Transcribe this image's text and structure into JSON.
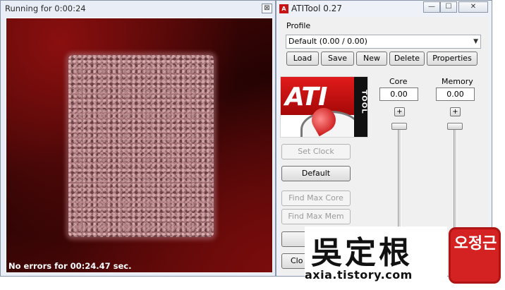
{
  "render_window": {
    "title": "Running for 0:00:24",
    "close_glyph": "⊠",
    "status_text": "No errors for 00:24.47 sec.",
    "colors": {
      "background": "#3a0505",
      "fur": "#a06d70"
    }
  },
  "atitool": {
    "title": "ATITool 0.27",
    "caption_buttons": {
      "minimize": "—",
      "maximize": "☐",
      "close": "✕"
    },
    "profile": {
      "label": "Profile",
      "selected": "Default (0.00 / 0.00)",
      "buttons": {
        "load": "Load",
        "save": "Save",
        "new": "New",
        "delete": "Delete",
        "properties": "Properties"
      }
    },
    "logo": {
      "brand": "ATI",
      "sub": "TOOL"
    },
    "core": {
      "label": "Core",
      "value": "0.00",
      "plus": "+"
    },
    "memory": {
      "label": "Memory",
      "value": "0.00",
      "plus": "+"
    },
    "actions": {
      "set_clock": "Set Clock",
      "default": "Default",
      "find_max_core": "Find Max Core",
      "find_max_mem": "Find Max Mem",
      "close_partial": "Clo"
    }
  },
  "watermark": {
    "chars": "吳定根",
    "url": "axia.tistory.com",
    "seal": "오정근"
  }
}
